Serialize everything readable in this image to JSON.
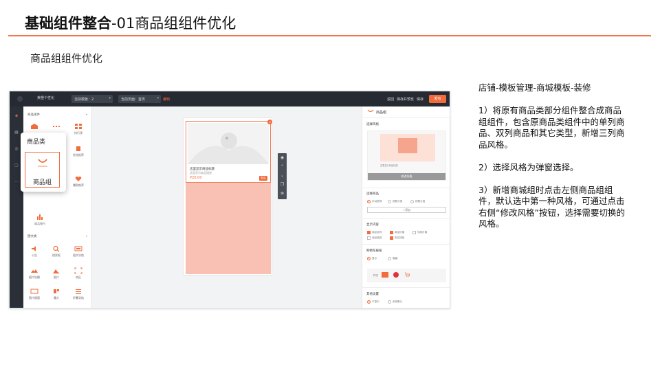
{
  "slide": {
    "title_bold": "基础组件整合",
    "title_rest": "-01商品组组件优化",
    "subtitle": "商品组组件优化"
  },
  "editor": {
    "brand": "美橙个性化",
    "template_select": "当前模板：2",
    "page_select": "当前页面：首页",
    "page_link": "编辑",
    "top_links": [
      "返回",
      "保存并预览",
      "保存"
    ],
    "publish_label": "发布",
    "left_panel": {
      "section1": "商品组件",
      "section1_tiles": [
        "",
        "",
        "排行榜",
        "",
        "",
        "优选推荐",
        "",
        "",
        "爆款推荐",
        "商品排行"
      ],
      "section2": "图文类",
      "section2_tiles": [
        "公告",
        "搜索框",
        "图文导航",
        "图片轮播",
        "图片",
        "热区",
        "图片橱窗",
        "魔方",
        "折叠导航",
        "辅助线",
        "标题栏",
        "富文本"
      ]
    },
    "product_card": {
      "name": "这里显示商品标题",
      "desc": "这里显示商品描述",
      "price": "¥20.00",
      "buy": "购买"
    },
    "right_panel": {
      "title": "商品组",
      "style_label": "选择风格",
      "modify_button": "修改风格",
      "select_label": "选择商品",
      "select_opts": [
        "手动选择",
        "按照分类",
        "按照分组"
      ],
      "add_label": "+添加",
      "display_label": "显示内容",
      "display_opts": [
        "商品名称",
        "商品价格",
        "划线价格",
        "商品描述",
        "购买按钮"
      ],
      "buy_label": "购物车按钮",
      "buy_opts": [
        "显示",
        "隐藏"
      ],
      "style_word": "样式",
      "other_label": "其他设置",
      "other_opts": [
        "不显示",
        "系统默认"
      ]
    },
    "overlay": {
      "heading": "商品类",
      "item_label": "商品组"
    }
  },
  "notes": {
    "path": "店铺-模板管理-商城模板-装修",
    "point1": "1）将原有商品类部分组件整合成商品组组件，包含原商品类组件中的单列商品、双列商品和其它类型，新增三列商品风格。",
    "point2": "2）选择风格为弹窗选择。",
    "point3": "3）新增商城组时点击左侧商品组组件，默认选中第一种风格，可通过点击右侧“修改风格”按钮，选择需要切换的风格。"
  },
  "colors": {
    "accent": "#ee7a4a",
    "publish": "#f26b3a",
    "canvas_pink": "#f9c1b4",
    "topbar": "#262b33"
  }
}
